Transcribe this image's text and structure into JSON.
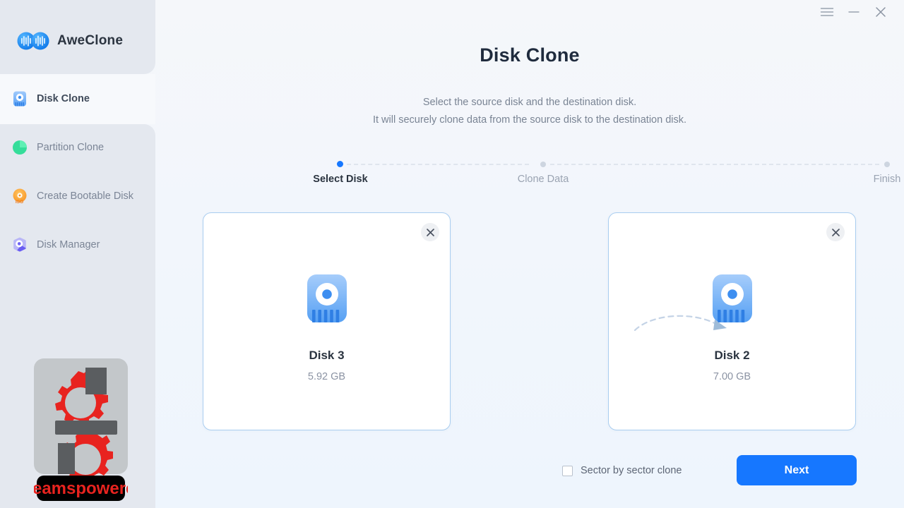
{
  "app": {
    "name": "AweClone",
    "logo_icon": "infinity-logo-icon",
    "accent_color": "#1677ff"
  },
  "titlebar": {
    "menu_label": "menu-icon",
    "minimize_label": "minimize-icon",
    "close_label": "close-icon"
  },
  "sidebar": {
    "items": [
      {
        "label": "Disk Clone",
        "icon": "hard-disk-icon",
        "active": true
      },
      {
        "label": "Partition Clone",
        "icon": "pie-partition-icon",
        "active": false
      },
      {
        "label": "Create Bootable Disk",
        "icon": "iso-disc-icon",
        "active": false
      },
      {
        "label": "Disk Manager",
        "icon": "disk-manager-icon",
        "active": false
      }
    ],
    "watermark": {
      "caption": "Steamspowered",
      "icon": "gear-watermark-icon",
      "caption_color": "#e8231f",
      "caption_bg": "#000000"
    }
  },
  "main": {
    "title": "Disk Clone",
    "subtitle_line1": "Select the source disk and the destination disk.",
    "subtitle_line2": "It will securely clone data from the source disk to the destination disk.",
    "stepper": [
      {
        "label": "Select Disk",
        "state": "active"
      },
      {
        "label": "Clone Data",
        "state": "idle"
      },
      {
        "label": "Finish",
        "state": "idle"
      }
    ],
    "cards": [
      {
        "role": "source",
        "name": "Disk 3",
        "size": "5.92 GB",
        "icon": "hard-disk-icon",
        "close_icon": "close-icon"
      },
      {
        "role": "destination",
        "name": "Disk 2",
        "size": "7.00 GB",
        "icon": "hard-disk-icon",
        "close_icon": "close-icon"
      }
    ],
    "flow_arrow_icon": "dashed-arrow-icon",
    "footer": {
      "sector_option_label": "Sector by sector clone",
      "sector_option_checked": false,
      "next_label": "Next"
    }
  }
}
